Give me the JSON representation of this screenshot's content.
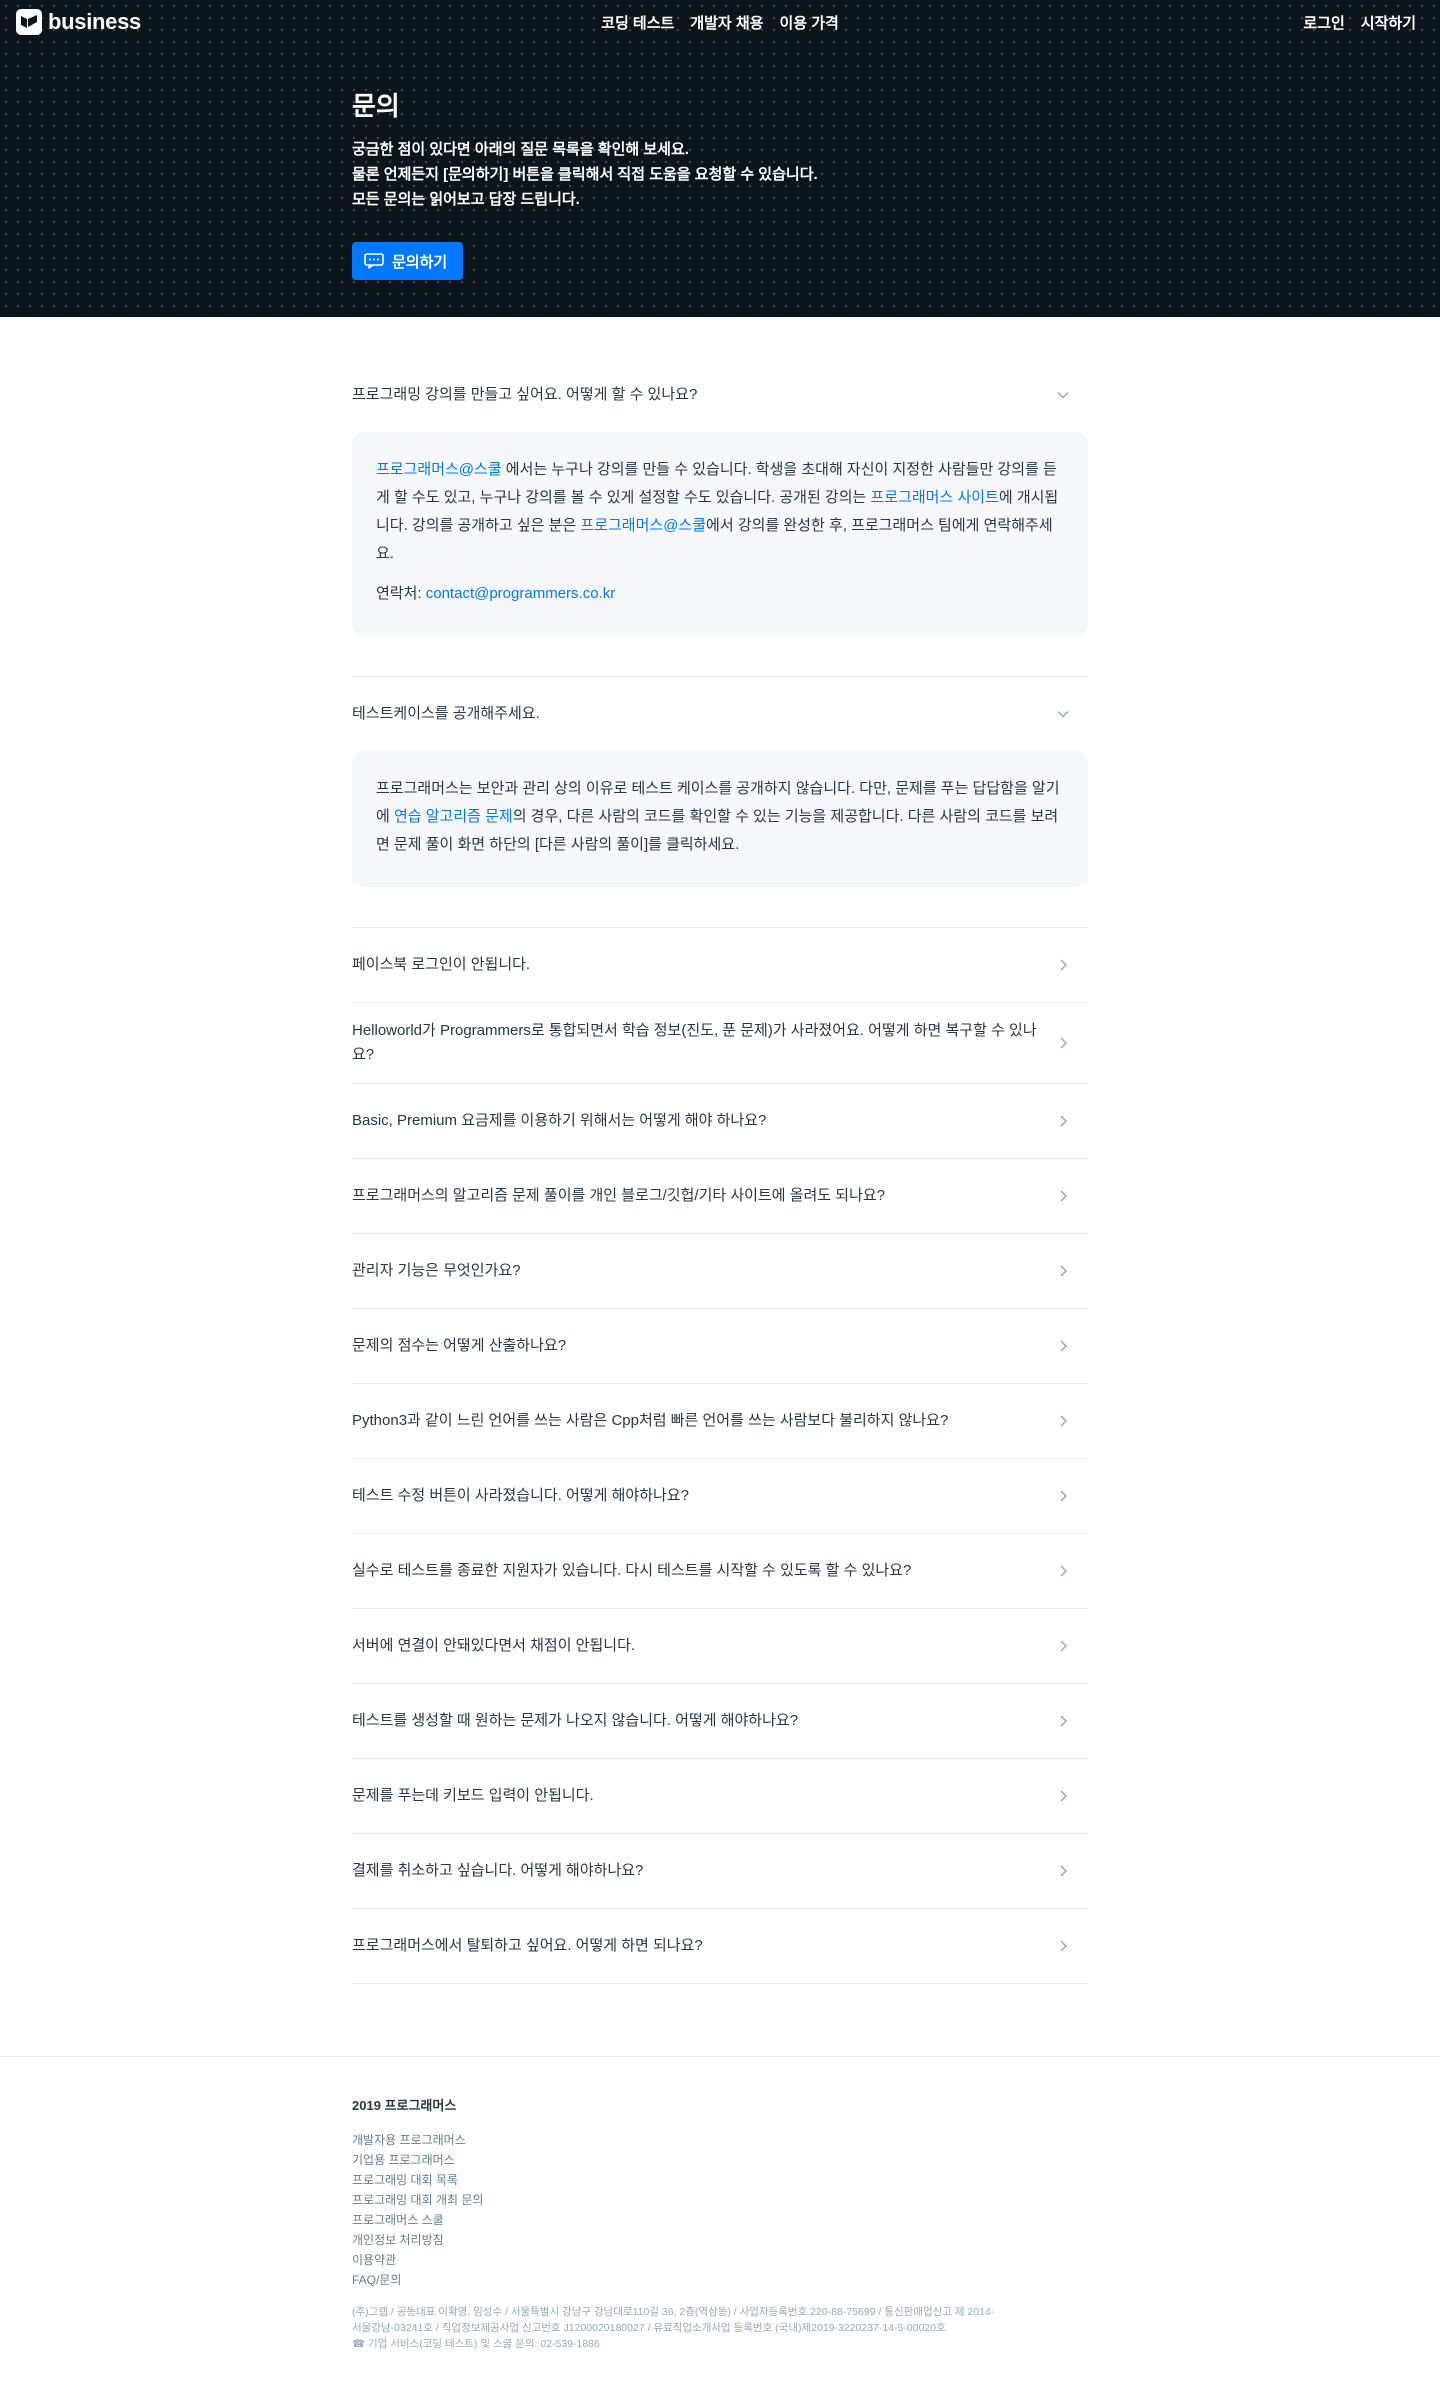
{
  "header": {
    "brand": "business",
    "nav": [
      "코딩 테스트",
      "개발자 채용",
      "이용 가격"
    ],
    "login": "로그인",
    "start": "시작하기"
  },
  "hero": {
    "title": "문의",
    "lines": [
      "궁금한 점이 있다면 아래의 질문 목록을 확인해 보세요.",
      "물론 언제든지 [문의하기] 버튼을 클릭해서 직접 도움을 요청할 수 있습니다.",
      "모든 문의는 읽어보고 답장 드립니다."
    ],
    "button": "문의하기"
  },
  "faq": {
    "open": [
      {
        "question": "프로그래밍 강의를 만들고 싶어요. 어떻게 할 수 있나요?",
        "answer": {
          "link1": "프로그래머스@스쿨",
          "t1": " 에서는 누구나 강의를 만들 수 있습니다. 학생을 초대해 자신이 지정한 사람들만 강의를 듣게 할 수도 있고, 누구나 강의를 볼 수 있게 설정할 수도 있습니다. 공개된 강의는 ",
          "link2": "프로그래머스 사이트",
          "t2": "에 개시됩니다. 강의를 공개하고 싶은 분은 ",
          "link3": "프로그래머스@스쿨",
          "t3": "에서 강의를 완성한 후, 프로그래머스 팀에게 연락해주세요.",
          "contact_label": "연락처: ",
          "contact_email": "contact@programmers.co.kr"
        }
      },
      {
        "question": "테스트케이스를 공개해주세요.",
        "answer": {
          "t1": "프로그래머스는 보안과 관리 상의 이유로 테스트 케이스를 공개하지 않습니다. 다만, 문제를 푸는 답답함을 알기에 ",
          "link1": "연습 알고리즘 문제",
          "t2": "의 경우, 다른 사람의 코드를 확인할 수 있는 기능을 제공합니다. 다른 사람의 코드를 보려면 문제 풀이 화면 하단의 [다른 사람의 풀이]를 클릭하세요."
        }
      }
    ],
    "closed": [
      "페이스북 로그인이 안됩니다.",
      "Helloworld가 Programmers로 통합되면서 학습 정보(진도, 푼 문제)가 사라졌어요. 어떻게 하면 복구할 수 있나요?",
      "Basic, Premium 요금제를 이용하기 위해서는 어떻게 해야 하나요?",
      "프로그래머스의 알고리즘 문제 풀이를 개인 블로그/깃헙/기타 사이트에 올려도 되나요?",
      "관리자 기능은 무엇인가요?",
      "문제의 점수는 어떻게 산출하나요?",
      "Python3과 같이 느린 언어를 쓰는 사람은 Cpp처럼 빠른 언어를 쓰는 사람보다 불리하지 않나요?",
      "테스트 수정 버튼이 사라졌습니다. 어떻게 해야하나요?",
      "실수로 테스트를 종료한 지원자가 있습니다. 다시 테스트를 시작할 수 있도록 할 수 있나요?",
      "서버에 연결이 안돼있다면서 채점이 안됩니다.",
      "테스트를 생성할 때 원하는 문제가 나오지 않습니다. 어떻게 해야하나요?",
      "문제를 푸는데 키보드 입력이 안됩니다.",
      "결제를 취소하고 싶습니다. 어떻게 해야하나요?",
      "프로그래머스에서 탈퇴하고 싶어요. 어떻게 하면 되나요?"
    ]
  },
  "footer": {
    "title": "2019 프로그래머스",
    "links": [
      "개발자용 프로그래머스",
      "기업용 프로그래머스",
      "프로그래밍 대회 목록",
      "프로그래밍 대회 개최 문의",
      "프로그래머스 스쿨",
      "개인정보 처리방침",
      "이용약관",
      "FAQ/문의"
    ],
    "info": [
      "(주)그렙 / 공동대표 이확영, 임성수 / 서울특별시 강남구 강남대로110길 36, 2층(역삼동) / 사업자등록번호 220-88-75699 / 통신판매업신고 제 2014-",
      "서울강남-03241호 / 직업정보제공사업 신고번호 J1200020180027 / 유료직업소개사업 등록번호 (국내)제2019-3220237-14-5-00020호",
      "☎ 기업 서비스(코딩 테스트) 및 스쿨 문의: 02-539-1886"
    ]
  },
  "colors": {
    "accent": "#0078ff",
    "hero_bg": "#0c151c",
    "answer_bg": "#f5f7fa",
    "text": "#263747"
  }
}
